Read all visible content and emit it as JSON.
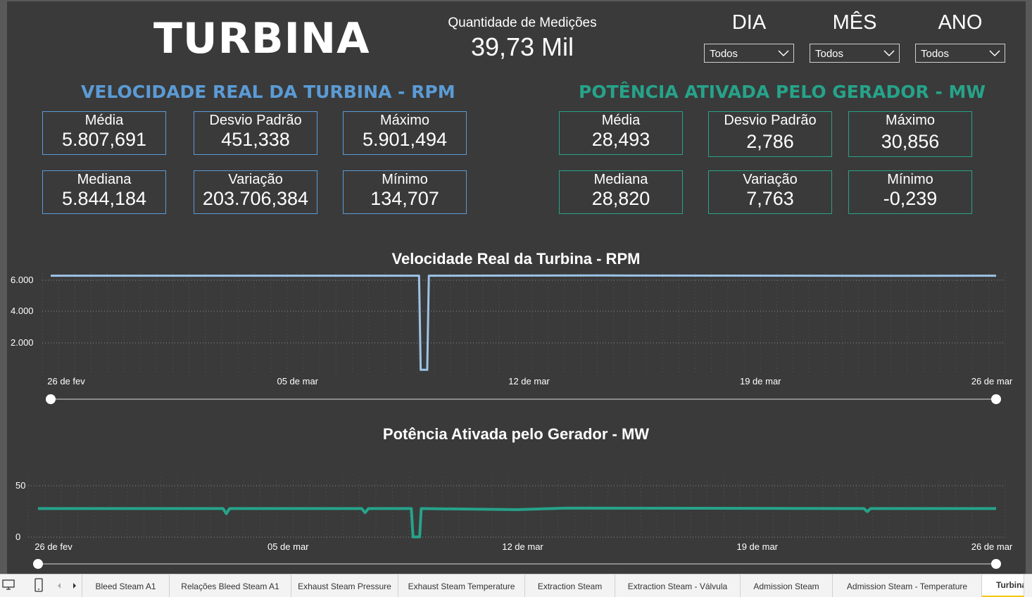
{
  "title": "TURBINA",
  "measurements": {
    "label": "Quantidade de Medições",
    "value": "39,73 Mil"
  },
  "filters": [
    {
      "label": "DIA",
      "selected": "Todos"
    },
    {
      "label": "MÊS",
      "selected": "Todos"
    },
    {
      "label": "ANO",
      "selected": "Todos"
    }
  ],
  "rpm": {
    "title": "VELOCIDADE REAL DA TURBINA - RPM",
    "color": "#5b9bd5",
    "cards": [
      {
        "label": "Média",
        "value": "5.807,691"
      },
      {
        "label": "Desvio Padrão",
        "value": "451,338"
      },
      {
        "label": "Máximo",
        "value": "5.901,494"
      },
      {
        "label": "Mediana",
        "value": "5.844,184"
      },
      {
        "label": "Variação",
        "value": "203.706,384"
      },
      {
        "label": "Mínimo",
        "value": "134,707"
      }
    ]
  },
  "mw": {
    "title": "POTÊNCIA ATIVADA PELO GERADOR - MW",
    "color": "#26a38a",
    "cards": [
      {
        "label": "Média",
        "value": "28,493"
      },
      {
        "label": "Desvio Padrão",
        "value": "2,786"
      },
      {
        "label": "Máximo",
        "value": "30,856"
      },
      {
        "label": "Mediana",
        "value": "28,820"
      },
      {
        "label": "Variação",
        "value": "7,763"
      },
      {
        "label": "Mínimo",
        "value": "-0,239"
      }
    ]
  },
  "chart_data": [
    {
      "type": "line",
      "title": "Velocidade Real da Turbina - RPM",
      "color": "#9cc3e6",
      "x_ticks": [
        "26 de fev",
        "05 de mar",
        "12 de mar",
        "19 de mar",
        "26 de mar"
      ],
      "y_ticks": [
        "6.000",
        "4.000",
        "2.000"
      ],
      "ylim": [
        0,
        6000
      ],
      "xlim": [
        0,
        29
      ],
      "grid": true,
      "series": [
        {
          "points": [
            [
              0,
              5850
            ],
            [
              11.3,
              5850
            ],
            [
              11.35,
              200
            ],
            [
              11.55,
              200
            ],
            [
              11.6,
              5850
            ],
            [
              17,
              5860
            ],
            [
              25,
              5840
            ],
            [
              29,
              5850
            ]
          ]
        }
      ]
    },
    {
      "type": "line",
      "title": "Potência Ativada pelo Gerador - MW",
      "color": "#26a38a",
      "x_ticks": [
        "26 de fev",
        "05 de mar",
        "12 de mar",
        "19 de mar",
        "26 de mar"
      ],
      "y_ticks": [
        "50",
        "0"
      ],
      "ylim": [
        0,
        60
      ],
      "xlim": [
        0,
        29
      ],
      "grid": true,
      "series": [
        {
          "points": [
            [
              0,
              29
            ],
            [
              5.6,
              29
            ],
            [
              5.7,
              24
            ],
            [
              5.8,
              29
            ],
            [
              9.8,
              29
            ],
            [
              9.9,
              25
            ],
            [
              10,
              29
            ],
            [
              11.3,
              29
            ],
            [
              11.35,
              1
            ],
            [
              11.55,
              1
            ],
            [
              11.6,
              29
            ],
            [
              14.5,
              28
            ],
            [
              16,
              29.5
            ],
            [
              25,
              29
            ],
            [
              25.1,
              26
            ],
            [
              25.2,
              29
            ],
            [
              29,
              29
            ]
          ]
        }
      ]
    }
  ],
  "tabs": [
    "Bleed Steam A1",
    "Relações Bleed Steam A1",
    "Exhaust Steam Pressure",
    "Exhaust Steam Temperature",
    "Extraction Steam",
    "Extraction Steam - Válvula",
    "Admission Steam",
    "Admission Steam - Temperature",
    "Turbina"
  ]
}
